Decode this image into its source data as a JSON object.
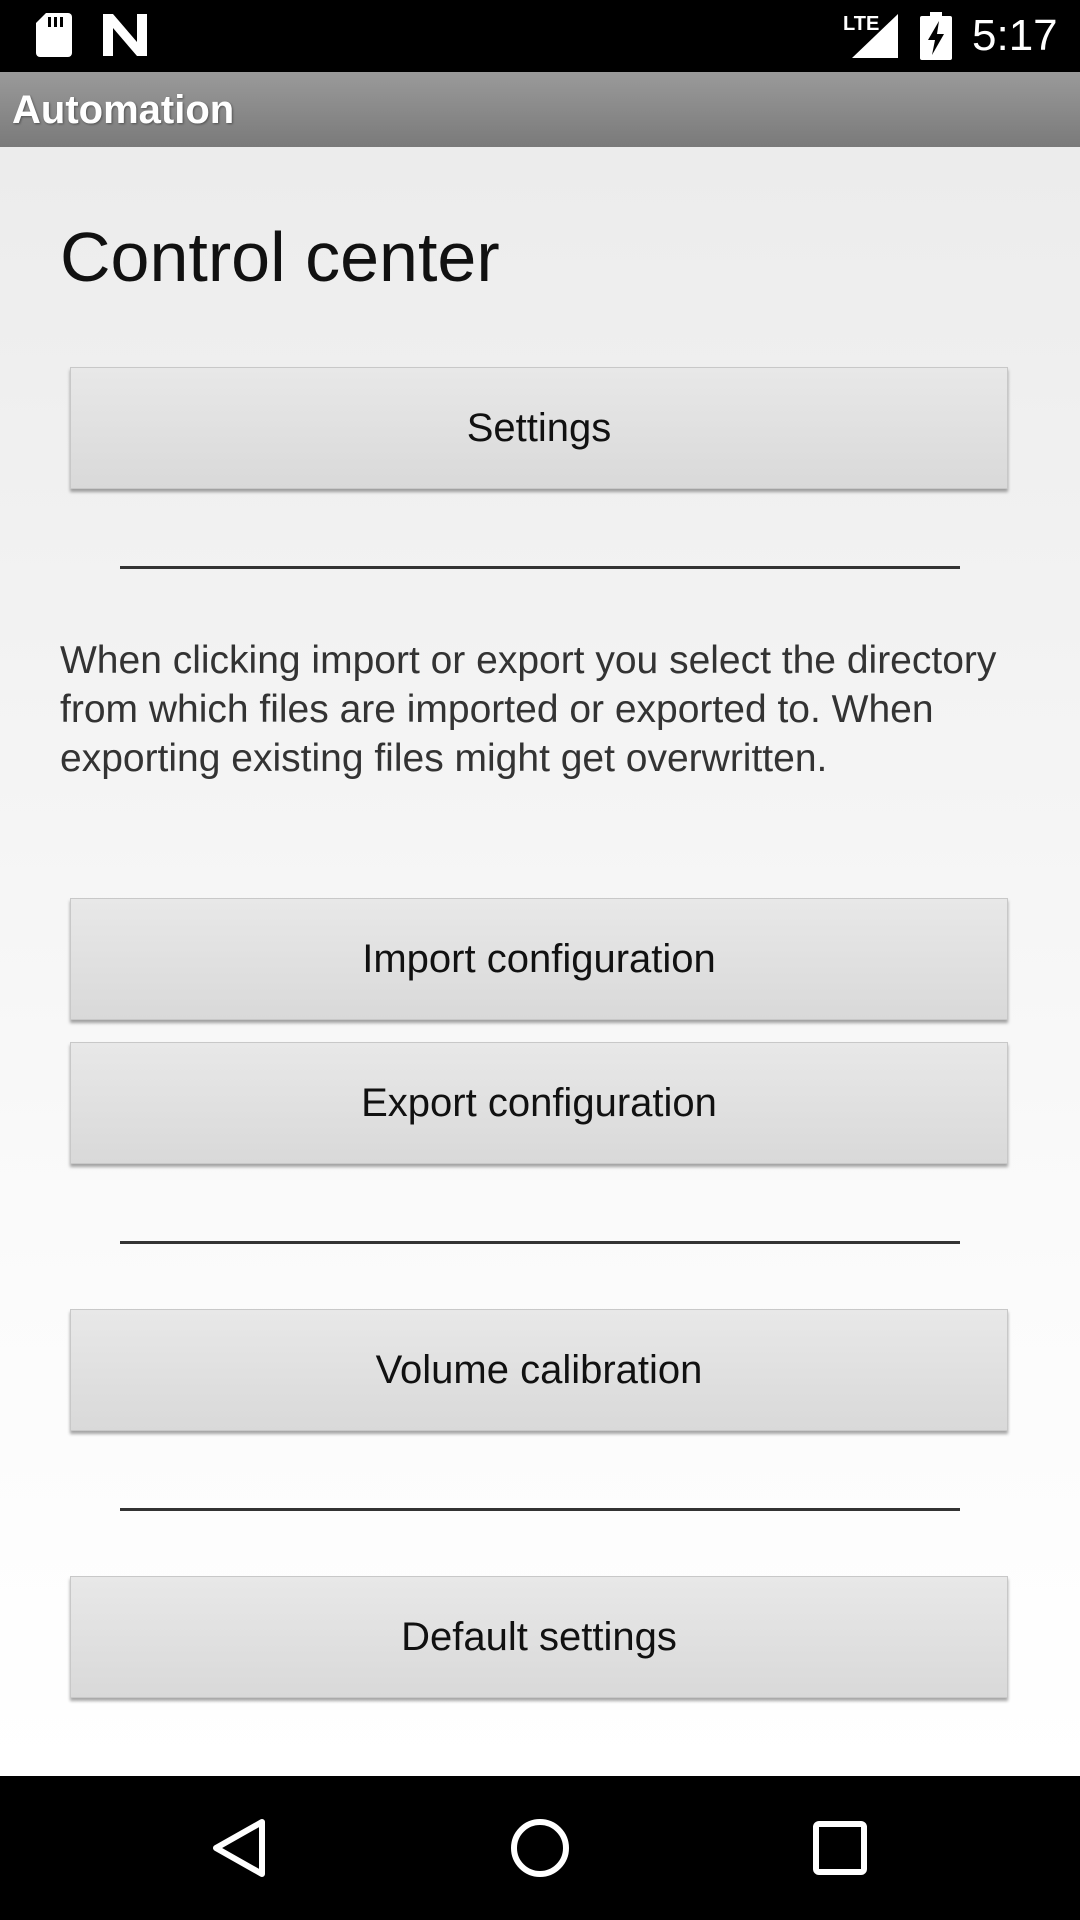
{
  "status_bar": {
    "network_label": "LTE",
    "time": "5:17",
    "icons": [
      "sd-card-icon",
      "n-notification-icon",
      "signal-icon",
      "battery-charging-icon"
    ]
  },
  "app_bar": {
    "title": "Automation"
  },
  "main": {
    "title": "Control center",
    "settings_label": "Settings",
    "description": "When clicking import or export you select the directory from which files are imported or exported to. When exporting existing files might get overwritten.",
    "import_label": "Import configuration",
    "export_label": "Export configuration",
    "volume_label": "Volume calibration",
    "defaults_label": "Default settings"
  },
  "nav_bar": {
    "icons": [
      "back-icon",
      "home-icon",
      "recents-icon"
    ]
  },
  "colors": {
    "app_bar": "#888888",
    "button": "#dedede",
    "background": "#f0f0f0"
  }
}
